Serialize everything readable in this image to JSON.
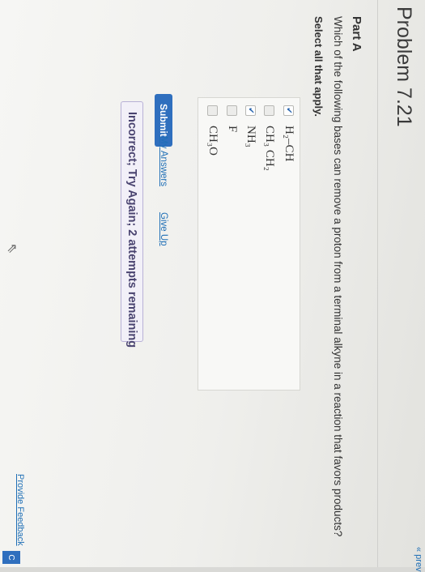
{
  "problem": {
    "title": "Problem 7.21",
    "prev_link": "« prev"
  },
  "part": {
    "label": "Part A",
    "question": "Which of the following bases can remove a proton from a terminal alkyne in a reaction that favors products?",
    "instruction": "Select all that apply."
  },
  "options": [
    {
      "label": "H₂–CH",
      "checked": true
    },
    {
      "label": "CH₃ CH₂",
      "checked": false
    },
    {
      "label": "NH₃",
      "checked": true
    },
    {
      "label": "F",
      "checked": false
    },
    {
      "label": "CH₃O",
      "checked": false
    }
  ],
  "actions": {
    "submit_label": "Submit",
    "my_answers_label": "My Answers",
    "give_up_label": "Give Up"
  },
  "feedback": {
    "text": "Incorrect; Try Again; 2 attempts remaining"
  },
  "footer": {
    "provide_feedback_label": "Provide Feedback",
    "edge_button_label": "C"
  },
  "colors": {
    "accent": "#2f6fbe",
    "link": "#1f6fb6"
  }
}
